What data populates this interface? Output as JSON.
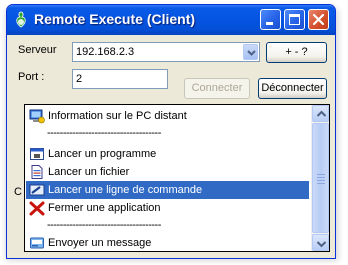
{
  "window": {
    "title": "Remote Execute (Client)",
    "colors": {
      "titlebar": "#0554e2",
      "selection": "#316ac5",
      "face": "#ece9d8"
    }
  },
  "titlebar_buttons": {
    "minimize": "minimize-icon",
    "maximize": "maximize-icon",
    "close": "close-icon"
  },
  "form": {
    "server_label": "Serveur",
    "server_value": "192.168.2.3",
    "port_label": "Port :",
    "port_value": "2",
    "plus_minus_label": "+ - ?",
    "connect_label": "Connecter",
    "disconnect_label": "Déconnecter",
    "partial_label": "C"
  },
  "dropdown": {
    "items": [
      {
        "label": "Information sur le PC distant",
        "icon": "computer-info-icon"
      },
      {
        "separator": "------------------------------------"
      },
      {
        "label": "Lancer un programme",
        "icon": "program-window-icon"
      },
      {
        "label": "Lancer un fichier",
        "icon": "file-icon"
      },
      {
        "label": "Lancer une ligne de commande",
        "icon": "command-line-icon",
        "selected": true
      },
      {
        "label": "Fermer une application",
        "icon": "close-x-icon"
      },
      {
        "separator": "------------------------------------"
      },
      {
        "label": "Envoyer un message",
        "icon": "message-icon"
      }
    ]
  }
}
